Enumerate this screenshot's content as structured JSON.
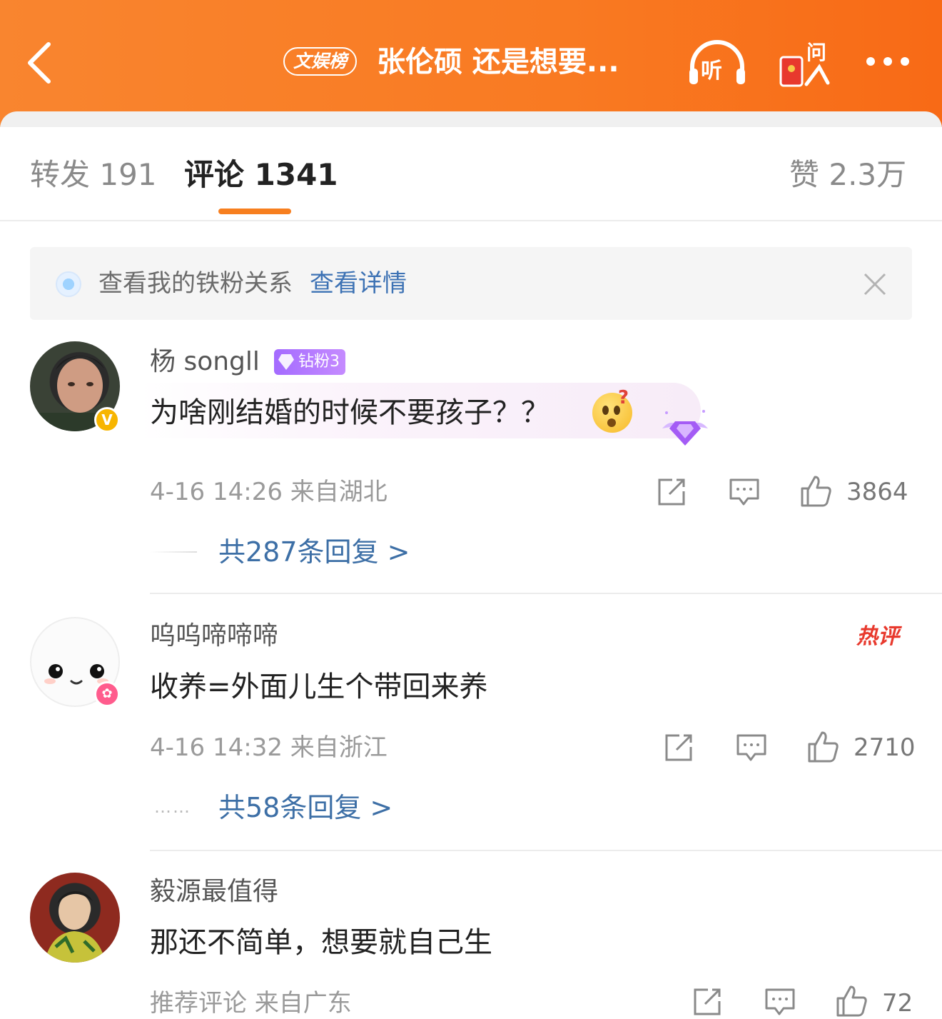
{
  "header": {
    "topic_tag": "文娱榜",
    "title": "张伦硕 还是想要...",
    "listen_label": "听",
    "ask_label": "问"
  },
  "tabs": {
    "repost_label": "转发 191",
    "comments_label": "评论 1341",
    "likes_label": "赞 2.3万"
  },
  "fan_banner": {
    "text": "查看我的铁粉关系",
    "link": "查看详情"
  },
  "comments": [
    {
      "username": "杨 songll",
      "fan_badge": "钻粉3",
      "text": "为啥刚结婚的时候不要孩子？？",
      "time_location": "4-16 14:26  来自湖北",
      "likes": "3864",
      "replies": "共287条回复 >"
    },
    {
      "username": "呜呜啼啼啼",
      "hot_tag": "热评",
      "text": "收养=外面儿生个带回来养",
      "time_location": "4-16 14:32  来自浙江",
      "likes": "2710",
      "replies": "共58条回复 >",
      "reply_dots": "……"
    },
    {
      "username": "毅源最值得",
      "text": "那还不简单，想要就自己生",
      "time_location": "推荐评论  来自广东",
      "likes": "72"
    }
  ],
  "colors": {
    "header_orange": "#f97a22",
    "tab_underline": "#f77f1f",
    "link_blue": "#3d6fa6",
    "hot_red": "#e8392d"
  }
}
